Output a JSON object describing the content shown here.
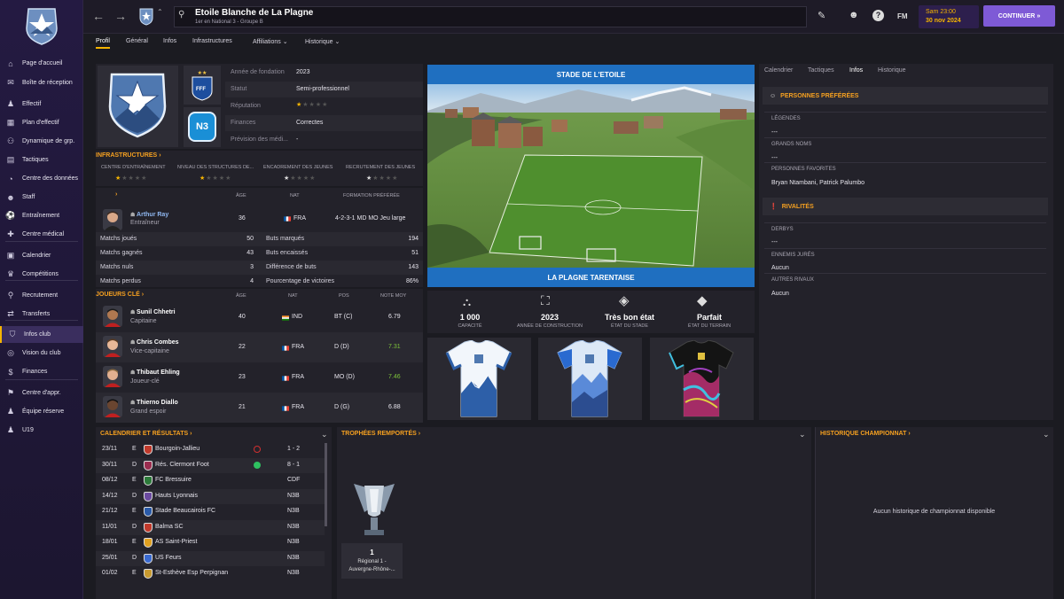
{
  "sidebar": {
    "items": [
      {
        "label": "Page d'accueil",
        "icon": "home-icon",
        "glyph": "⌂"
      },
      {
        "label": "Boîte de réception",
        "icon": "inbox-icon",
        "glyph": "✉"
      },
      {
        "label": "Effectif",
        "icon": "squad-icon",
        "glyph": "♟"
      },
      {
        "label": "Plan d'effectif",
        "icon": "squad-plan-icon",
        "glyph": "▦"
      },
      {
        "label": "Dynamique de grp.",
        "icon": "dynamics-icon",
        "glyph": "⚇"
      },
      {
        "label": "Tactiques",
        "icon": "tactics-icon",
        "glyph": "▤"
      },
      {
        "label": "Centre des données",
        "icon": "data-icon",
        "glyph": "◔"
      },
      {
        "label": "Staff",
        "icon": "staff-icon",
        "glyph": "☻"
      },
      {
        "label": "Entraînement",
        "icon": "training-icon",
        "glyph": "⚽"
      },
      {
        "label": "Centre médical",
        "icon": "medical-icon",
        "glyph": "✚"
      },
      {
        "label": "Calendrier",
        "icon": "calendar-icon",
        "glyph": "▣"
      },
      {
        "label": "Compétitions",
        "icon": "trophy-icon",
        "glyph": "♛"
      },
      {
        "label": "Recrutement",
        "icon": "scouting-icon",
        "glyph": "⚲"
      },
      {
        "label": "Transferts",
        "icon": "transfer-icon",
        "glyph": "⇄"
      },
      {
        "label": "Infos club",
        "icon": "club-info-icon",
        "glyph": "⛉"
      },
      {
        "label": "Vision du club",
        "icon": "club-vision-icon",
        "glyph": "◎"
      },
      {
        "label": "Finances",
        "icon": "finances-icon",
        "glyph": "$"
      },
      {
        "label": "Centre d'appr.",
        "icon": "academy-icon",
        "glyph": "⚑"
      },
      {
        "label": "Équipe réserve",
        "icon": "reserve-icon",
        "glyph": "♟"
      },
      {
        "label": "U19",
        "icon": "u19-icon",
        "glyph": "♟"
      }
    ]
  },
  "topbar": {
    "club_name": "Etoile Blanche de La Plagne",
    "club_sub": "1er en National 3 - Groupe B",
    "fm_label": "FM",
    "date_time": "Sam 23:00",
    "date": "30 nov 2024",
    "continue_label": "CONTINUER"
  },
  "tabs": [
    "Profil",
    "Général",
    "Infos",
    "Infrastructures",
    "Affiliations",
    "Historique"
  ],
  "info": {
    "rows": [
      {
        "label": "Année de fondation",
        "value": "2023"
      },
      {
        "label": "Statut",
        "value": "Semi-professionnel"
      },
      {
        "label": "Réputation",
        "value": ""
      },
      {
        "label": "Finances",
        "value": "Correctes"
      },
      {
        "label": "Prévision des médi...",
        "value": "-"
      }
    ],
    "badge_n3": "N3",
    "badge_fff": "FFF"
  },
  "infra": {
    "title": "INFRASTRUCTURES",
    "cols": [
      "CENTRE D'ENTRAÎNEMENT",
      "NIVEAU DES STRUCTURES DE...",
      "ENCADREMENT DES JEUNES",
      "RECRUTEMENT DES JEUNES"
    ]
  },
  "coach": {
    "headers": [
      "ÂGE",
      "NAT",
      "FORMATION PRÉFÉRÉE"
    ],
    "name": "Arthur Ray",
    "role": "Entraîneur",
    "age": "36",
    "nat": "FRA",
    "formation": "4-2-3-1 MD MO Jeu large",
    "stats_left": [
      {
        "label": "Matchs joués",
        "value": "50"
      },
      {
        "label": "Matchs gagnés",
        "value": "43"
      },
      {
        "label": "Matchs nuls",
        "value": "3"
      },
      {
        "label": "Matchs perdus",
        "value": "4"
      }
    ],
    "stats_right": [
      {
        "label": "Buts marqués",
        "value": "194"
      },
      {
        "label": "Buts encaissés",
        "value": "51"
      },
      {
        "label": "Différence de buts",
        "value": "143"
      },
      {
        "label": "Pourcentage de victoires",
        "value": "86%"
      }
    ]
  },
  "key_players": {
    "title": "JOUEURS CLÉ",
    "headers": [
      "ÂGE",
      "NAT",
      "POS",
      "NOTE MOY"
    ],
    "players": [
      {
        "name": "Sunil Chhetri",
        "role": "Capitaine",
        "age": "40",
        "nat": "IND",
        "pos": "BT (C)",
        "rating": "6.79",
        "rating_color": "#e6e4ec"
      },
      {
        "name": "Chris Combes",
        "role": "Vice-capitaine",
        "age": "22",
        "nat": "FRA",
        "pos": "D (D)",
        "rating": "7.31",
        "rating_color": "#7cc23a"
      },
      {
        "name": "Thibaut Ehling",
        "role": "Joueur-clé",
        "age": "23",
        "nat": "FRA",
        "pos": "MO (D)",
        "rating": "7.46",
        "rating_color": "#7cc23a"
      },
      {
        "name": "Thierno Diallo",
        "role": "Grand espoir",
        "age": "21",
        "nat": "FRA",
        "pos": "D (G)",
        "rating": "6.88",
        "rating_color": "#e6e4ec"
      }
    ]
  },
  "stadium": {
    "name": "STADE DE L'ETOILE",
    "area": "LA PLAGNE TARENTAISE",
    "stats": [
      {
        "value": "1 000",
        "label": "CAPACITÉ"
      },
      {
        "value": "2023",
        "label": "ANNÉE DE CONSTRUCTION"
      },
      {
        "value": "Très bon état",
        "label": "ÉTAT DU STADE"
      },
      {
        "value": "Parfait",
        "label": "ÉTAT DU TERRAIN"
      }
    ]
  },
  "right": {
    "tabs": [
      "Calendrier",
      "Tactiques",
      "Infos",
      "Historique"
    ],
    "fav_title": "PERSONNES PRÉFÉRÉES",
    "fav": [
      {
        "label": "LÉGENDES",
        "value": "---"
      },
      {
        "label": "GRANDS NOMS",
        "value": "---"
      },
      {
        "label": "PERSONNES FAVORITES",
        "value": "Bryan Ntambani, Patrick Palumbo"
      }
    ],
    "riv_title": "RIVALITÉS",
    "riv": [
      {
        "label": "DERBYS",
        "value": "---"
      },
      {
        "label": "ENNEMIS JURÉS",
        "value": "Aucun"
      },
      {
        "label": "AUTRES RIVAUX",
        "value": "Aucun"
      }
    ]
  },
  "fixtures": {
    "title": "CALENDRIER ET RÉSULTATS",
    "rows": [
      {
        "date": "23/11",
        "venue": "E",
        "team": "Bourgoin-Jallieu",
        "result": "1 - 2",
        "mark": "loss",
        "color": "#c0392b"
      },
      {
        "date": "30/11",
        "venue": "D",
        "team": "Rés. Clermont Foot",
        "result": "8 - 1",
        "mark": "win",
        "color": "#9b2d4f"
      },
      {
        "date": "08/12",
        "venue": "E",
        "team": "FC Bressuire",
        "result": "CDF",
        "mark": "",
        "color": "#2c7a3a"
      },
      {
        "date": "14/12",
        "venue": "D",
        "team": "Hauts Lyonnais",
        "result": "N3B",
        "mark": "",
        "color": "#6b4aa0"
      },
      {
        "date": "21/12",
        "venue": "E",
        "team": "Stade Beaucairois FC",
        "result": "N3B",
        "mark": "",
        "color": "#2a5aa8"
      },
      {
        "date": "11/01",
        "venue": "D",
        "team": "Balma SC",
        "result": "N3B",
        "mark": "",
        "color": "#c0392b"
      },
      {
        "date": "18/01",
        "venue": "E",
        "team": "AS Saint-Priest",
        "result": "N3B",
        "mark": "",
        "color": "#e0a020"
      },
      {
        "date": "25/01",
        "venue": "D",
        "team": "US Feurs",
        "result": "N3B",
        "mark": "",
        "color": "#3a6ad0"
      },
      {
        "date": "01/02",
        "venue": "E",
        "team": "St-Esthève Esp Perpignan",
        "result": "N3B",
        "mark": "",
        "color": "#c89a30"
      }
    ]
  },
  "trophies": {
    "title": "TROPHÉES REMPORTÉS",
    "count": "1",
    "name1": "Régional 1 -",
    "name2": "Auvergne-Rhône-..."
  },
  "history": {
    "title": "HISTORIQUE CHAMPIONNAT",
    "empty": "Aucun historique de championnat disponible"
  }
}
